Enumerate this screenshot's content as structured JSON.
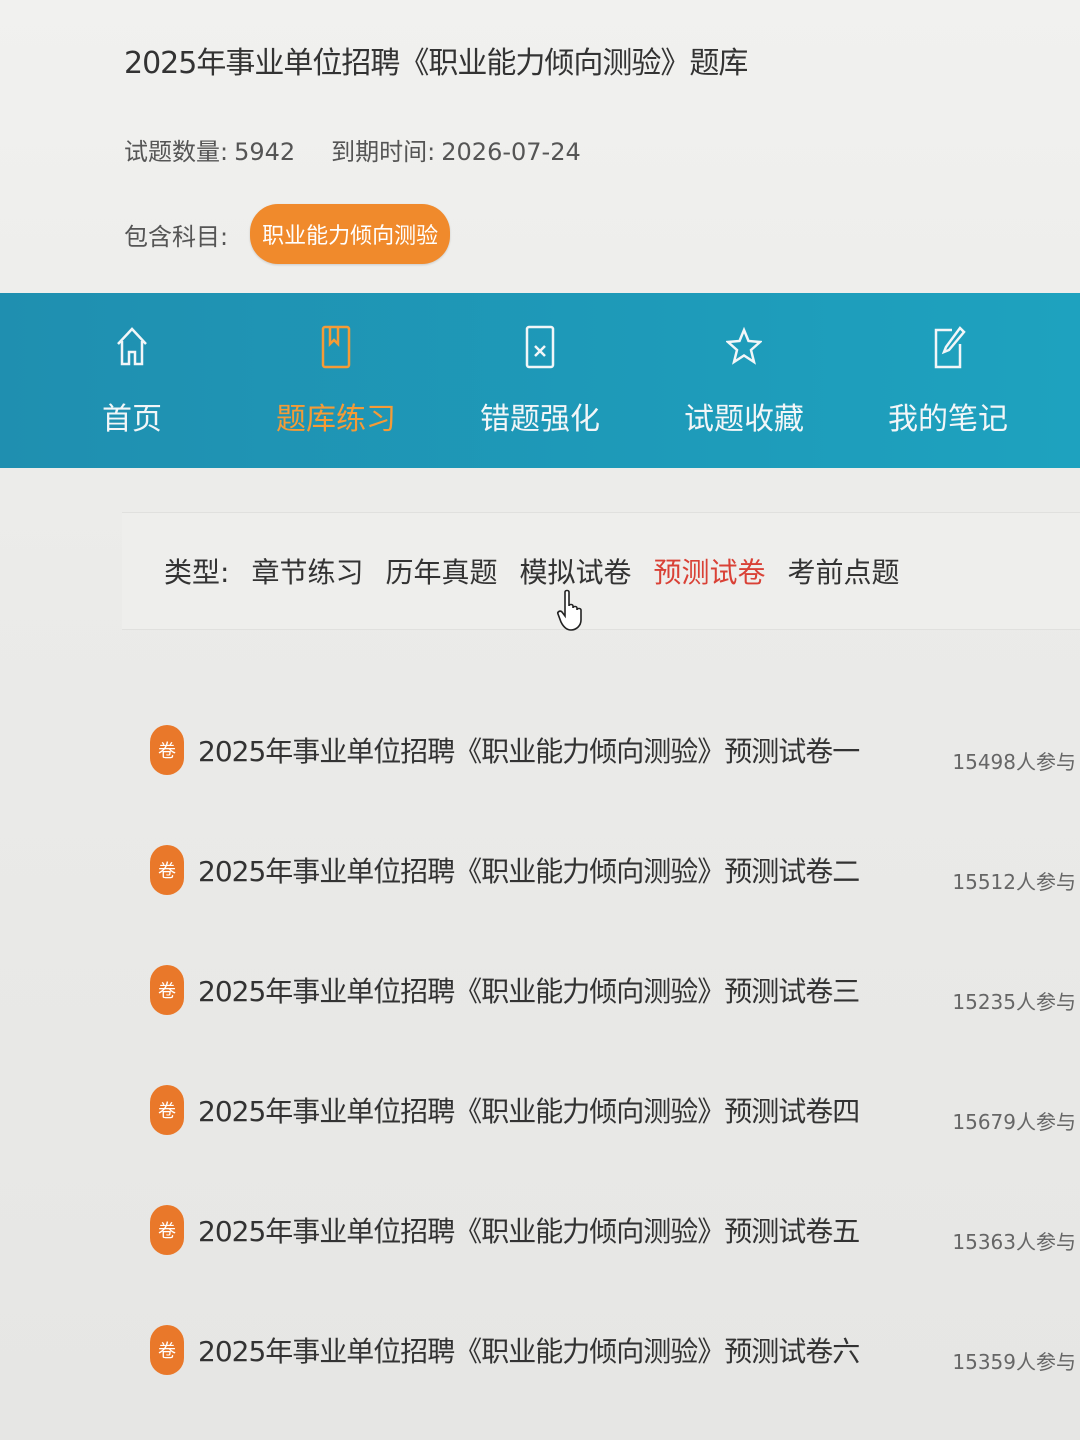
{
  "header": {
    "title": "2025年事业单位招聘《职业能力倾向测验》题库",
    "question_count_label": "试题数量:",
    "question_count": "5942",
    "expiry_label": "到期时间:",
    "expiry_date": "2026-07-24",
    "subjects_label": "包含科目:",
    "subject": "职业能力倾向测验"
  },
  "nav": {
    "items": [
      {
        "label": "首页",
        "icon": "home-icon"
      },
      {
        "label": "题库练习",
        "icon": "book-icon"
      },
      {
        "label": "错题强化",
        "icon": "wrong-doc-icon"
      },
      {
        "label": "试题收藏",
        "icon": "star-icon"
      },
      {
        "label": "我的笔记",
        "icon": "note-edit-icon"
      }
    ],
    "active_index": 1,
    "bg_color": "#1f98b8",
    "active_color": "#f59b36"
  },
  "types": {
    "label": "类型:",
    "tabs": [
      "章节练习",
      "历年真题",
      "模拟试卷",
      "预测试卷",
      "考前点题"
    ],
    "active_index": 3,
    "active_color": "#d94136"
  },
  "papers": [
    {
      "badge": "卷",
      "title": "2025年事业单位招聘《职业能力倾向测验》预测试卷一",
      "participants": "15498人参与"
    },
    {
      "badge": "卷",
      "title": "2025年事业单位招聘《职业能力倾向测验》预测试卷二",
      "participants": "15512人参与"
    },
    {
      "badge": "卷",
      "title": "2025年事业单位招聘《职业能力倾向测验》预测试卷三",
      "participants": "15235人参与"
    },
    {
      "badge": "卷",
      "title": "2025年事业单位招聘《职业能力倾向测验》预测试卷四",
      "participants": "15679人参与"
    },
    {
      "badge": "卷",
      "title": "2025年事业单位招聘《职业能力倾向测验》预测试卷五",
      "participants": "15363人参与"
    },
    {
      "badge": "卷",
      "title": "2025年事业单位招聘《职业能力倾向测验》预测试卷六",
      "participants": "15359人参与"
    }
  ],
  "colors": {
    "badge": "#e9782a",
    "pill": "#f08a2c"
  }
}
